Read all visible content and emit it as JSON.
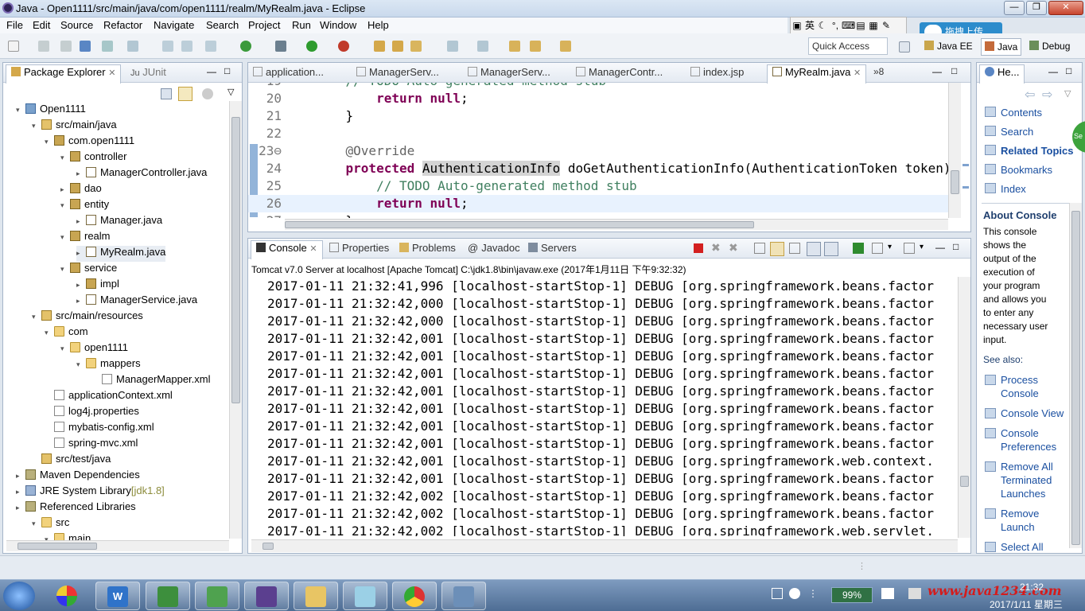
{
  "window": {
    "title": "Java - Open1111/src/main/java/com/open1111/realm/MyRealm.java - Eclipse"
  },
  "menu": [
    "File",
    "Edit",
    "Source",
    "Refactor",
    "Navigate",
    "Search",
    "Project",
    "Run",
    "Window",
    "Help"
  ],
  "ime": {
    "lang": "英",
    "upload_label": "拖拽上传"
  },
  "toolbar": {
    "quick_access": "Quick Access",
    "perspectives": [
      "Java EE",
      "Java",
      "Debug"
    ]
  },
  "package_explorer": {
    "tabs": [
      "Package Explorer",
      "JUnit"
    ],
    "tree": [
      {
        "label": "Open1111",
        "icon": "project-icon",
        "twisty": "▾"
      },
      {
        "label": "src/main/java",
        "icon": "package-folder-icon",
        "twisty": "▾"
      },
      {
        "label": "com.open1111",
        "icon": "package-icon",
        "twisty": "▾"
      },
      {
        "label": "controller",
        "icon": "package-icon",
        "twisty": "▾"
      },
      {
        "label": "ManagerController.java",
        "icon": "java-file-icon",
        "twisty": "▸"
      },
      {
        "label": "dao",
        "icon": "package-icon",
        "twisty": "▸"
      },
      {
        "label": "entity",
        "icon": "package-icon",
        "twisty": "▾"
      },
      {
        "label": "Manager.java",
        "icon": "java-file-icon",
        "twisty": "▸"
      },
      {
        "label": "realm",
        "icon": "package-icon",
        "twisty": "▾"
      },
      {
        "label": "MyRealm.java",
        "icon": "java-file-icon",
        "twisty": "▸"
      },
      {
        "label": "service",
        "icon": "package-icon",
        "twisty": "▾"
      },
      {
        "label": "impl",
        "icon": "package-icon",
        "twisty": "▸"
      },
      {
        "label": "ManagerService.java",
        "icon": "java-interface-icon",
        "twisty": "▸"
      },
      {
        "label": "src/main/resources",
        "icon": "package-folder-icon",
        "twisty": "▾"
      },
      {
        "label": "com",
        "icon": "folder-icon",
        "twisty": "▾"
      },
      {
        "label": "open1111",
        "icon": "folder-icon",
        "twisty": "▾"
      },
      {
        "label": "mappers",
        "icon": "folder-icon",
        "twisty": "▾"
      },
      {
        "label": "ManagerMapper.xml",
        "icon": "xml-file-icon",
        "twisty": ""
      },
      {
        "label": "applicationContext.xml",
        "icon": "xml-file-icon",
        "twisty": ""
      },
      {
        "label": "log4j.properties",
        "icon": "properties-file-icon",
        "twisty": ""
      },
      {
        "label": "mybatis-config.xml",
        "icon": "xml-file-icon",
        "twisty": ""
      },
      {
        "label": "spring-mvc.xml",
        "icon": "xml-file-icon",
        "twisty": ""
      },
      {
        "label": "src/test/java",
        "icon": "package-folder-icon",
        "twisty": ""
      },
      {
        "label": "Maven Dependencies",
        "icon": "library-icon",
        "twisty": "▸"
      },
      {
        "label": "JRE System Library",
        "suffix": "[jdk1.8]",
        "icon": "jre-icon",
        "twisty": "▸"
      },
      {
        "label": "Referenced Libraries",
        "icon": "library-icon",
        "twisty": "▸"
      },
      {
        "label": "src",
        "icon": "folder-icon",
        "twisty": "▾"
      },
      {
        "label": "main",
        "icon": "folder-icon",
        "twisty": "▾"
      }
    ]
  },
  "editor": {
    "tabs": [
      "application...",
      "ManagerServ...",
      "ManagerServ...",
      "ManagerContr...",
      "index.jsp",
      "MyRealm.java",
      "»8"
    ],
    "lines": [
      {
        "num": "19",
        "segments": [
          {
            "t": "    ",
            "c": ""
          },
          {
            "t": "// TODO Auto-generated method stub",
            "c": "cm"
          }
        ]
      },
      {
        "num": "20",
        "segments": [
          {
            "t": "        ",
            "c": ""
          },
          {
            "t": "return",
            "c": "kw"
          },
          {
            "t": " ",
            "c": ""
          },
          {
            "t": "null",
            "c": "kw"
          },
          {
            "t": ";",
            "c": ""
          }
        ]
      },
      {
        "num": "21",
        "segments": [
          {
            "t": "    }",
            "c": ""
          }
        ]
      },
      {
        "num": "22",
        "segments": [
          {
            "t": "",
            "c": ""
          }
        ]
      },
      {
        "num": "23⊖",
        "segments": [
          {
            "t": "    ",
            "c": ""
          },
          {
            "t": "@Override",
            "c": "ann"
          }
        ]
      },
      {
        "num": "24",
        "segments": [
          {
            "t": "    ",
            "c": ""
          },
          {
            "t": "protected",
            "c": "kw"
          },
          {
            "t": " ",
            "c": ""
          },
          {
            "t": "AuthenticationInfo",
            "c": "hl"
          },
          {
            "t": " doGetAuthenticationInfo(AuthenticationToken token)",
            "c": ""
          }
        ]
      },
      {
        "num": "25",
        "segments": [
          {
            "t": "        ",
            "c": ""
          },
          {
            "t": "// TODO Auto-generated method stub",
            "c": "cm"
          }
        ]
      },
      {
        "num": "26",
        "segments": [
          {
            "t": "        ",
            "c": ""
          },
          {
            "t": "return",
            "c": "kw"
          },
          {
            "t": " ",
            "c": ""
          },
          {
            "t": "null",
            "c": "kw"
          },
          {
            "t": ";",
            "c": ""
          }
        ]
      },
      {
        "num": "27",
        "segments": [
          {
            "t": "    }",
            "c": ""
          }
        ]
      }
    ]
  },
  "console": {
    "tabs": [
      "Console",
      "Properties",
      "Problems",
      "Javadoc",
      "Servers"
    ],
    "header": "Tomcat v7.0 Server at localhost [Apache Tomcat] C:\\jdk1.8\\bin\\javaw.exe (2017年1月11日 下午9:32:32)",
    "lines": [
      "2017-01-11 21:32:41,996 [localhost-startStop-1] DEBUG [org.springframework.beans.factor",
      "2017-01-11 21:32:42,000 [localhost-startStop-1] DEBUG [org.springframework.beans.factor",
      "2017-01-11 21:32:42,000 [localhost-startStop-1] DEBUG [org.springframework.beans.factor",
      "2017-01-11 21:32:42,001 [localhost-startStop-1] DEBUG [org.springframework.beans.factor",
      "2017-01-11 21:32:42,001 [localhost-startStop-1] DEBUG [org.springframework.beans.factor",
      "2017-01-11 21:32:42,001 [localhost-startStop-1] DEBUG [org.springframework.beans.factor",
      "2017-01-11 21:32:42,001 [localhost-startStop-1] DEBUG [org.springframework.beans.factor",
      "2017-01-11 21:32:42,001 [localhost-startStop-1] DEBUG [org.springframework.beans.factor",
      "2017-01-11 21:32:42,001 [localhost-startStop-1] DEBUG [org.springframework.beans.factor",
      "2017-01-11 21:32:42,001 [localhost-startStop-1] DEBUG [org.springframework.beans.factor",
      "2017-01-11 21:32:42,001 [localhost-startStop-1] DEBUG [org.springframework.web.context.",
      "2017-01-11 21:32:42,001 [localhost-startStop-1] DEBUG [org.springframework.beans.factor",
      "2017-01-11 21:32:42,002 [localhost-startStop-1] DEBUG [org.springframework.beans.factor",
      "2017-01-11 21:32:42,002 [localhost-startStop-1] DEBUG [org.springframework.beans.factor",
      "2017-01-11 21:32:42,002 [localhost-startStop-1] DEBUG [org.springframework.web.servlet."
    ]
  },
  "help": {
    "tab": "He...",
    "links": [
      "Contents",
      "Search",
      "Related Topics",
      "Bookmarks",
      "Index"
    ],
    "about_title": "About Console",
    "about_text": [
      "This console",
      "shows the",
      "output of the",
      "execution of",
      "your program",
      "and allows you",
      "to enter any",
      "necessary user",
      "input."
    ],
    "see_also": "See also:",
    "see_links": [
      [
        "Process",
        "Console"
      ],
      [
        "Console View"
      ],
      [
        "Console",
        "Preferences"
      ],
      [
        "Remove All",
        "Terminated",
        "Launches"
      ],
      [
        "Remove",
        "Launch"
      ],
      [
        "Select All"
      ]
    ]
  },
  "taskbar": {
    "battery": "99%",
    "time": "21:32",
    "date": "2017/1/11 星期三",
    "watermark": "www.java1234.com"
  }
}
